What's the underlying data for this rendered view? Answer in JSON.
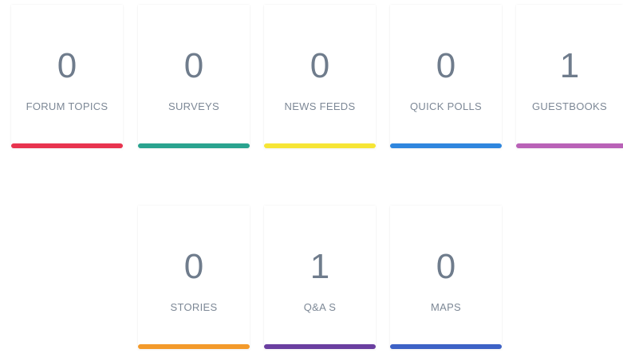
{
  "stats": [
    {
      "key": "forum-topics",
      "count": "0",
      "label": "FORUM TOPICS",
      "color": "#e8344f"
    },
    {
      "key": "surveys",
      "count": "0",
      "label": "SURVEYS",
      "color": "#2aa38f"
    },
    {
      "key": "news-feeds",
      "count": "0",
      "label": "NEWS FEEDS",
      "color": "#f6e536"
    },
    {
      "key": "quick-polls",
      "count": "0",
      "label": "QUICK POLLS",
      "color": "#2f86de"
    },
    {
      "key": "guestbooks",
      "count": "1",
      "label": "GUESTBOOKS",
      "color": "#b962b7"
    },
    {
      "key": "stories",
      "count": "0",
      "label": "STORIES",
      "color": "#f39a2b"
    },
    {
      "key": "qas",
      "count": "1",
      "label": "Q&A S",
      "color": "#6a3fa0"
    },
    {
      "key": "maps",
      "count": "0",
      "label": "MAPS",
      "color": "#3d62c6"
    }
  ]
}
